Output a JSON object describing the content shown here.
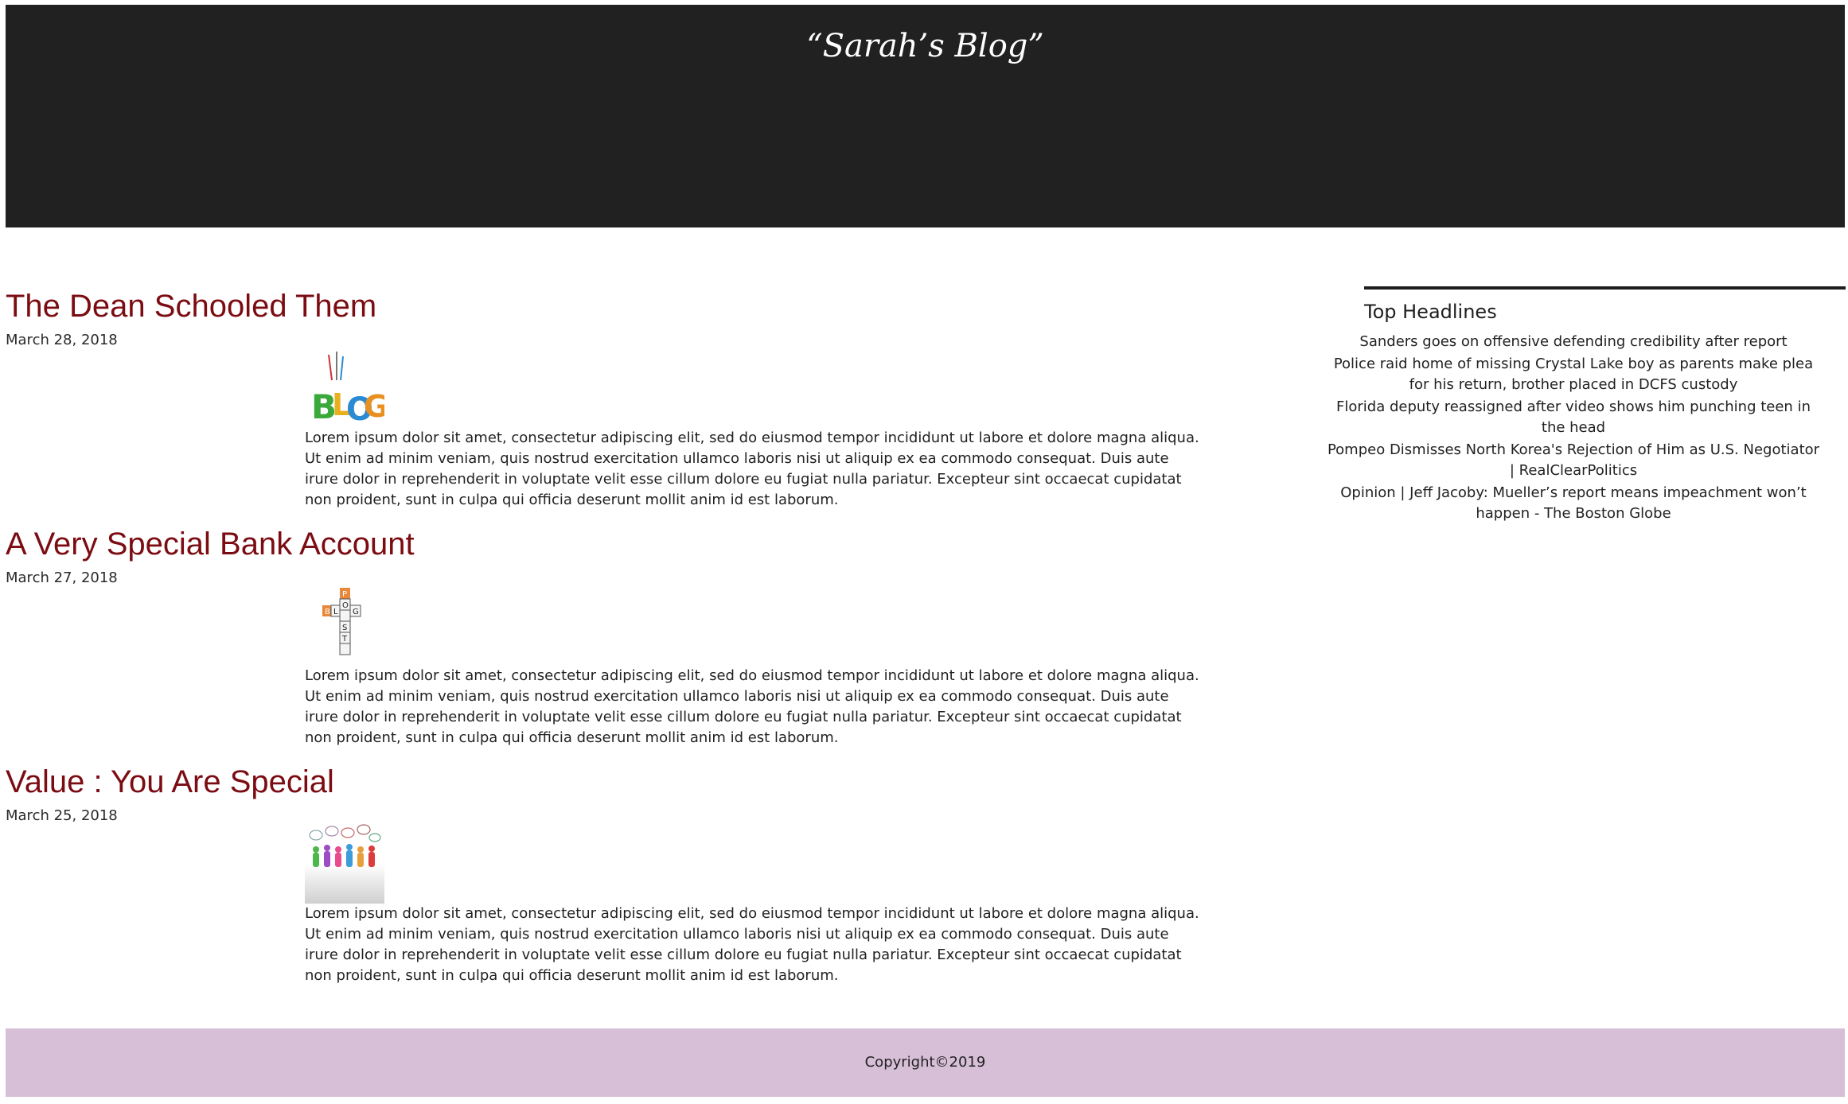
{
  "header": {
    "title": "“Sarah’s Blog”"
  },
  "posts": [
    {
      "title": "The Dean Schooled Them",
      "date": "March 28, 2018",
      "image": "blog-letters-image",
      "body": "Lorem ipsum dolor sit amet, consectetur adipiscing elit, sed do eiusmod tempor incididunt ut labore et dolore magna aliqua. Ut enim ad minim veniam, quis nostrud exercitation ullamco laboris nisi ut aliquip ex ea commodo consequat. Duis aute irure dolor in reprehenderit in voluptate velit esse cillum dolore eu fugiat nulla pariatur. Excepteur sint occaecat cupidatat non proident, sunt in culpa qui officia deserunt mollit anim id est laborum."
    },
    {
      "title": "A Very Special Bank Account",
      "date": "March 27, 2018",
      "image": "blog-post-crossword-image",
      "body": "Lorem ipsum dolor sit amet, consectetur adipiscing elit, sed do eiusmod tempor incididunt ut labore et dolore magna aliqua. Ut enim ad minim veniam, quis nostrud exercitation ullamco laboris nisi ut aliquip ex ea commodo consequat. Duis aute irure dolor in reprehenderit in voluptate velit esse cillum dolore eu fugiat nulla pariatur. Excepteur sint occaecat cupidatat non proident, sunt in culpa qui officia deserunt mollit anim id est laborum."
    },
    {
      "title": "Value : You Are Special",
      "date": "March 25, 2018",
      "image": "people-speech-bubbles-image",
      "body": "Lorem ipsum dolor sit amet, consectetur adipiscing elit, sed do eiusmod tempor incididunt ut labore et dolore magna aliqua. Ut enim ad minim veniam, quis nostrud exercitation ullamco laboris nisi ut aliquip ex ea commodo consequat. Duis aute irure dolor in reprehenderit in voluptate velit esse cillum dolore eu fugiat nulla pariatur. Excepteur sint occaecat cupidatat non proident, sunt in culpa qui officia deserunt mollit anim id est laborum."
    }
  ],
  "sidebar": {
    "title": "Top Headlines",
    "headlines": [
      "Sanders goes on offensive defending credibility after report",
      "Police raid home of missing Crystal Lake boy as parents make plea for his return, brother placed in DCFS custody",
      "Florida deputy reassigned after video shows him punching teen in the head",
      "Pompeo Dismisses North Korea's Rejection of Him as U.S. Negotiator | RealClearPolitics",
      "Opinion | Jeff Jacoby: Mueller’s report means impeachment won’t happen - The Boston Globe"
    ]
  },
  "footer": {
    "copyright": "Copyright©2019"
  },
  "colors": {
    "header_bg": "#212121",
    "post_title": "#7b0c12",
    "footer_bg": "#d7bfd7",
    "sidebar_rule": "#1e1e1e"
  }
}
